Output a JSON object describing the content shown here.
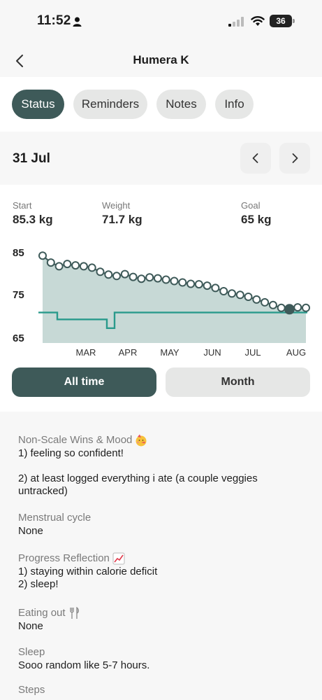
{
  "status_bar": {
    "time": "11:52",
    "battery": "36",
    "icons": [
      "person-icon",
      "signal-icon",
      "wifi-icon",
      "battery-icon"
    ]
  },
  "header": {
    "title": "Humera K",
    "back_icon": "chevron-left-icon"
  },
  "tabs": [
    {
      "label": "Status",
      "active": true
    },
    {
      "label": "Reminders",
      "active": false
    },
    {
      "label": "Notes",
      "active": false
    },
    {
      "label": "Info",
      "active": false
    }
  ],
  "date_nav": {
    "date": "31 Jul",
    "prev_icon": "chevron-left-icon",
    "next_icon": "chevron-right-icon"
  },
  "stats": {
    "start_label": "Start",
    "start_value": "85.3 kg",
    "weight_label": "Weight",
    "weight_value": "71.7 kg",
    "goal_label": "Goal",
    "goal_value": "65 kg"
  },
  "colors": {
    "accent": "#3e5a59",
    "goal_line": "#2a9a8c",
    "fill": "#c7d9d6"
  },
  "chart_data": {
    "type": "line",
    "y_ticks": [
      "85",
      "75",
      "65"
    ],
    "ylim": [
      65,
      85
    ],
    "x_ticks": [
      "MAR",
      "APR",
      "MAY",
      "JUN",
      "JUL",
      "AUG"
    ],
    "series": [
      {
        "values": [
          83.3,
          81.8,
          81.0,
          81.5,
          81.2,
          81.0,
          80.7,
          79.8,
          79.2,
          78.9,
          79.3,
          78.7,
          78.3,
          78.6,
          78.4,
          78.1,
          77.8,
          77.5,
          77.2,
          77.1,
          76.8,
          76.3,
          75.6,
          75.1,
          74.8,
          74.4,
          73.8,
          73.2,
          72.6,
          72.0,
          71.7,
          72.1,
          72.0
        ]
      },
      {
        "name": "goal",
        "steps": [
          {
            "from": "start",
            "value": 71.0
          },
          {
            "from": "mar-early",
            "value": 69.5
          },
          {
            "from": "apr-early",
            "value": 67.6
          },
          {
            "from": "apr-mid",
            "value": 71.0
          }
        ]
      }
    ]
  },
  "range_buttons": [
    {
      "label": "All time",
      "active": true
    },
    {
      "label": "Month",
      "active": false
    }
  ],
  "notes": {
    "wins_label": "Non-Scale Wins & Mood",
    "wins_icon": "partying-face-icon",
    "wins_value": "1) feeling so confident!\n\n2) at least logged everything i ate (a couple veggies untracked)",
    "cycle_label": "Menstrual cycle",
    "cycle_value": "None",
    "reflection_label": "Progress Reflection",
    "reflection_icon": "chart-increasing-icon",
    "reflection_value": "1) staying within calorie deficit\n2) sleep!",
    "eating_label": "Eating out",
    "eating_icon": "fork-knife-icon",
    "eating_value": "None",
    "sleep_label": "Sleep",
    "sleep_value": "Sooo random like 5-7 hours.",
    "steps_label": "Steps"
  }
}
